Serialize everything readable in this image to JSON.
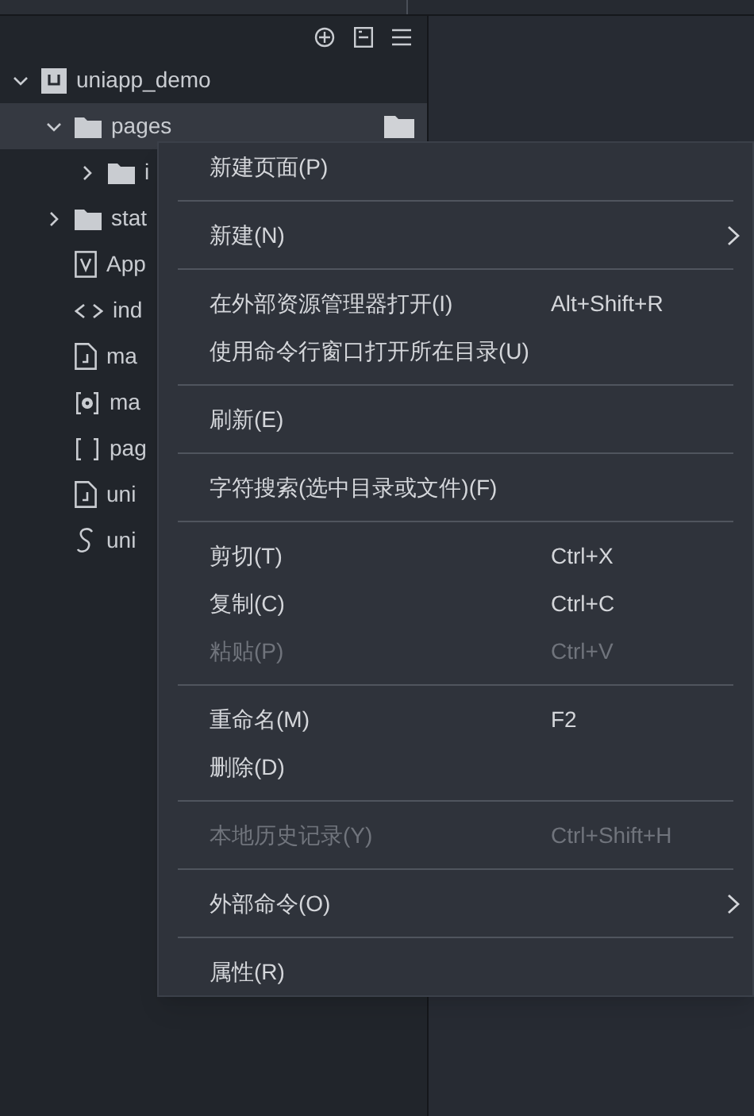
{
  "tree": [
    {
      "name": "uniapp_demo",
      "kind": "project",
      "expanded": true,
      "selected": false,
      "children": [
        {
          "name": "pages",
          "kind": "folder",
          "expanded": true,
          "selected": true,
          "children": [
            {
              "name": "i",
              "kind": "folder",
              "expanded": false,
              "selected": false
            }
          ]
        },
        {
          "name": "stat",
          "kind": "folder",
          "expanded": false,
          "selected": false
        },
        {
          "name": "App",
          "kind": "vue",
          "selected": false
        },
        {
          "name": "ind",
          "kind": "html",
          "selected": false
        },
        {
          "name": "ma",
          "kind": "js",
          "selected": false
        },
        {
          "name": "ma",
          "kind": "config",
          "selected": false
        },
        {
          "name": "pag",
          "kind": "json",
          "selected": false
        },
        {
          "name": "uni",
          "kind": "js",
          "selected": false
        },
        {
          "name": "uni",
          "kind": "style",
          "selected": false
        }
      ]
    }
  ],
  "context_menu": [
    {
      "kind": "item",
      "label": "新建页面(P)",
      "disabled": false
    },
    {
      "kind": "separator"
    },
    {
      "kind": "item",
      "label": "新建(N)",
      "disabled": false,
      "submenu": true
    },
    {
      "kind": "separator"
    },
    {
      "kind": "item",
      "label": "在外部资源管理器打开(I)",
      "shortcut": "Alt+Shift+R",
      "disabled": false
    },
    {
      "kind": "item",
      "label": "使用命令行窗口打开所在目录(U)",
      "disabled": false
    },
    {
      "kind": "separator"
    },
    {
      "kind": "item",
      "label": "刷新(E)",
      "disabled": false
    },
    {
      "kind": "separator"
    },
    {
      "kind": "item",
      "label": "字符搜索(选中目录或文件)(F)",
      "disabled": false
    },
    {
      "kind": "separator"
    },
    {
      "kind": "item",
      "label": "剪切(T)",
      "shortcut": "Ctrl+X",
      "disabled": false
    },
    {
      "kind": "item",
      "label": "复制(C)",
      "shortcut": "Ctrl+C",
      "disabled": false
    },
    {
      "kind": "item",
      "label": "粘贴(P)",
      "shortcut": "Ctrl+V",
      "disabled": true
    },
    {
      "kind": "separator"
    },
    {
      "kind": "item",
      "label": "重命名(M)",
      "shortcut": "F2",
      "disabled": false
    },
    {
      "kind": "item",
      "label": "删除(D)",
      "disabled": false
    },
    {
      "kind": "separator"
    },
    {
      "kind": "item",
      "label": "本地历史记录(Y)",
      "shortcut": "Ctrl+Shift+H",
      "disabled": true
    },
    {
      "kind": "separator"
    },
    {
      "kind": "item",
      "label": "外部命令(O)",
      "disabled": false,
      "submenu": true
    },
    {
      "kind": "separator"
    },
    {
      "kind": "item",
      "label": "属性(R)",
      "disabled": false
    }
  ]
}
